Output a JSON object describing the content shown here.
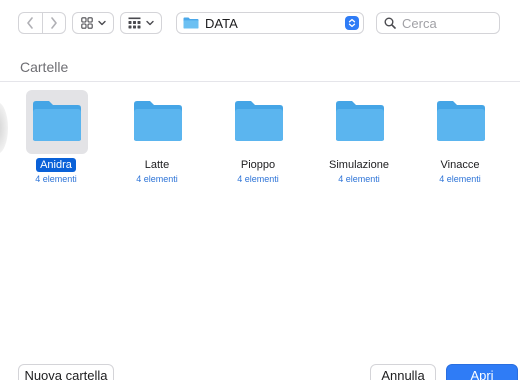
{
  "toolbar": {
    "path_label": "DATA",
    "search_placeholder": "Cerca",
    "icons": {
      "back": "chevron-left-icon",
      "forward": "chevron-right-icon",
      "view": "grid-view-icon",
      "group": "group-icon",
      "dropdown": "chevron-down-icon",
      "path_folder": "folder-icon",
      "path_popup": "popup-stepper-icon",
      "search": "search-icon"
    }
  },
  "section": {
    "title": "Cartelle"
  },
  "items": [
    {
      "name": "Anidra",
      "meta": "4 elementi",
      "selected": true
    },
    {
      "name": "Latte",
      "meta": "4 elementi",
      "selected": false
    },
    {
      "name": "Pioppo",
      "meta": "4 elementi",
      "selected": false
    },
    {
      "name": "Simulazione",
      "meta": "4 elementi",
      "selected": false
    },
    {
      "name": "Vinacce",
      "meta": "4 elementi",
      "selected": false
    }
  ],
  "footer": {
    "new_folder_label": "Nuova cartella",
    "cancel_label": "Annulla",
    "open_label": "Apri"
  },
  "colors": {
    "accent": "#2f7cf6",
    "selection": "#0a61d8",
    "folder": "#5bb5ef",
    "meta_text": "#2e74d7"
  }
}
